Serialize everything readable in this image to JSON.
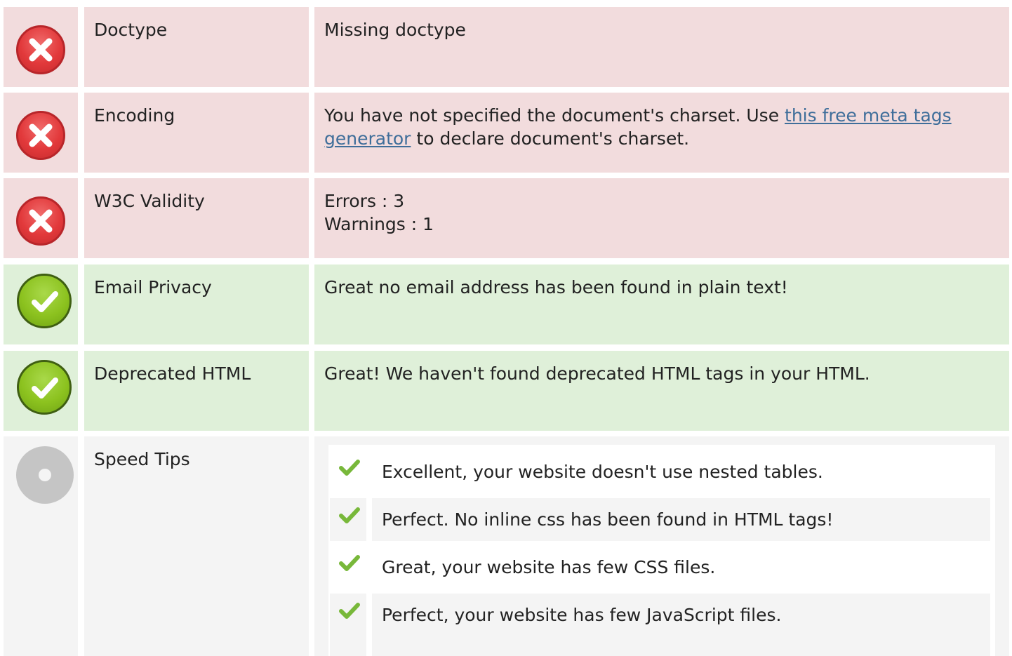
{
  "rows": [
    {
      "status": "error",
      "name": "Doctype",
      "desc_lines": [
        "Missing doctype"
      ]
    },
    {
      "status": "error",
      "name": "Encoding",
      "desc_prefix": "You have not specified the document's charset. Use ",
      "desc_link": "this free meta tags generator",
      "desc_suffix": " to declare document's charset."
    },
    {
      "status": "error",
      "name": "W3C Validity",
      "desc_lines": [
        "Errors : 3",
        "Warnings : 1"
      ]
    },
    {
      "status": "ok",
      "name": "Email Privacy",
      "desc_lines": [
        "Great no email address has been found in plain text!"
      ]
    },
    {
      "status": "ok",
      "name": "Deprecated HTML",
      "desc_lines": [
        "Great! We haven't found deprecated HTML tags in your HTML."
      ]
    },
    {
      "status": "neutral",
      "name": "Speed Tips",
      "tips": [
        "Excellent, your website doesn't use nested tables.",
        "Perfect. No inline css has been found in HTML tags!",
        "Great, your website has few CSS files.",
        "Perfect, your website has few JavaScript files.",
        ""
      ]
    }
  ],
  "icons": {
    "error": "error-x-icon",
    "ok": "checkmark-circle-icon",
    "neutral": "neutral-dot-icon",
    "tip": "check-icon"
  },
  "colors": {
    "error_bg": "#f2dcdd",
    "ok_bg": "#dff0d9",
    "neutral_bg": "#f4f4f4",
    "link": "#3f6e9a",
    "tip_check": "#78b83a"
  }
}
